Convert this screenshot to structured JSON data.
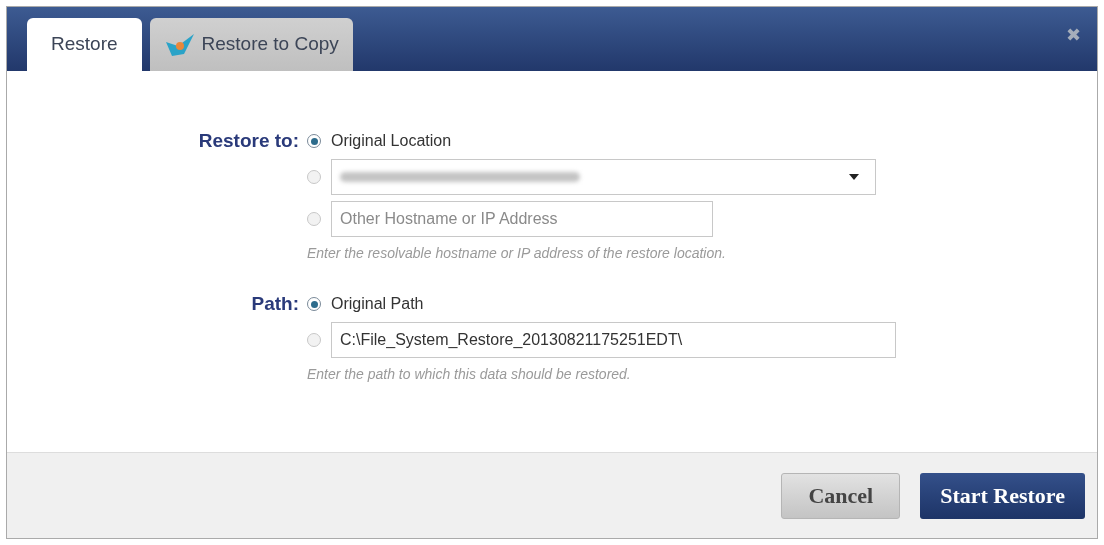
{
  "tabs": [
    {
      "label": "Restore",
      "selected": true,
      "icon": false
    },
    {
      "label": "Restore to Copy",
      "selected": false,
      "icon": true
    }
  ],
  "close": "✖",
  "groups": [
    {
      "label": "Restore to:",
      "options": [
        {
          "kind": "text",
          "selected": true,
          "text": "Original Location"
        },
        {
          "kind": "select",
          "selected": false,
          "redacted": true
        },
        {
          "kind": "input",
          "selected": false,
          "placeholder": "Other Hostname or IP Address"
        }
      ],
      "hint": "Enter the resolvable hostname or IP address of the restore location."
    },
    {
      "label": "Path:",
      "options": [
        {
          "kind": "text",
          "selected": true,
          "text": "Original Path"
        },
        {
          "kind": "input",
          "selected": false,
          "value": "C:\\File_System_Restore_20130821175251EDT\\"
        }
      ],
      "hint": "Enter the path to which this data should be restored."
    }
  ],
  "buttons": [
    {
      "label": "Cancel",
      "primary": false
    },
    {
      "label": "Start Restore",
      "primary": true
    }
  ]
}
